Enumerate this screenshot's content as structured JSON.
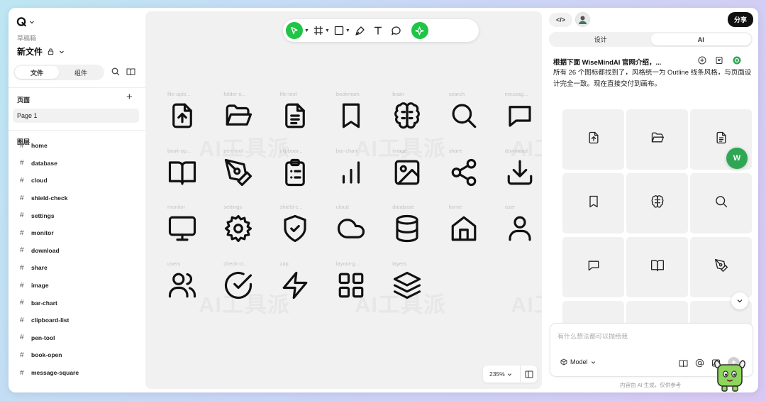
{
  "app": {
    "logo": "logo-icon"
  },
  "left": {
    "drafts_label": "草稿箱",
    "file_name": "新文件",
    "tabs": [
      {
        "label": "文件",
        "active": true
      },
      {
        "label": "组件",
        "active": false
      }
    ],
    "pages_title": "页面",
    "pages": [
      "Page 1"
    ],
    "layers_title": "图层",
    "layers": [
      "home",
      "database",
      "cloud",
      "shield-check",
      "settings",
      "monitor",
      "download",
      "share",
      "image",
      "bar-chart",
      "clipboard-list",
      "pen-tool",
      "book-open",
      "message-square"
    ]
  },
  "toolbar": {
    "tools": [
      "pointer-icon",
      "frame-icon",
      "rectangle-icon",
      "pen-icon",
      "text-icon",
      "comment-icon",
      "ai-sparkle-icon"
    ]
  },
  "canvas": {
    "icons": [
      {
        "label": "file-uplo...",
        "icon": "file-upload"
      },
      {
        "label": "folder-o...",
        "icon": "folder-open"
      },
      {
        "label": "file-text",
        "icon": "file-text"
      },
      {
        "label": "bookmark",
        "icon": "bookmark"
      },
      {
        "label": "brain",
        "icon": "brain"
      },
      {
        "label": "search",
        "icon": "search"
      },
      {
        "label": "messag...",
        "icon": "message-square"
      },
      {
        "label": "book-op...",
        "icon": "book-open"
      },
      {
        "label": "pen-tool",
        "icon": "pen-tool"
      },
      {
        "label": "clipboar...",
        "icon": "clipboard-list"
      },
      {
        "label": "bar-chart",
        "icon": "bar-chart"
      },
      {
        "label": "image",
        "icon": "image"
      },
      {
        "label": "share",
        "icon": "share"
      },
      {
        "label": "download",
        "icon": "download"
      },
      {
        "label": "monitor",
        "icon": "monitor"
      },
      {
        "label": "settings",
        "icon": "settings"
      },
      {
        "label": "shield-c...",
        "icon": "shield-check"
      },
      {
        "label": "cloud",
        "icon": "cloud"
      },
      {
        "label": "database",
        "icon": "database"
      },
      {
        "label": "home",
        "icon": "home"
      },
      {
        "label": "user",
        "icon": "user"
      },
      {
        "label": "users",
        "icon": "users"
      },
      {
        "label": "check-ci...",
        "icon": "check-circle"
      },
      {
        "label": "zap",
        "icon": "zap"
      },
      {
        "label": "layout-g...",
        "icon": "layout-grid"
      },
      {
        "label": "layers",
        "icon": "layers"
      }
    ],
    "zoom": "235%",
    "watermark": "AI工具派"
  },
  "right": {
    "code_label": "</>",
    "share_label": "分享",
    "tabs": [
      {
        "label": "设计",
        "active": false
      },
      {
        "label": "AI",
        "active": true
      }
    ],
    "chat_title": "根据下面 WiseMindAI 官网介绍，...",
    "message": "所有 26 个图标都找到了，风格统一为 Outline 线条风格，与页面设计完全一致。现在直接交付到画布。",
    "preview_icons": [
      "file-upload",
      "folder-open",
      "file-text",
      "bookmark",
      "brain",
      "search",
      "message-square",
      "book-open",
      "pen-tool"
    ],
    "badge_letter": "W",
    "input_placeholder": "有什么想法都可以抛给我",
    "model_label": "Model",
    "disclaimer": "内容由 AI 生成，仅供参考"
  }
}
